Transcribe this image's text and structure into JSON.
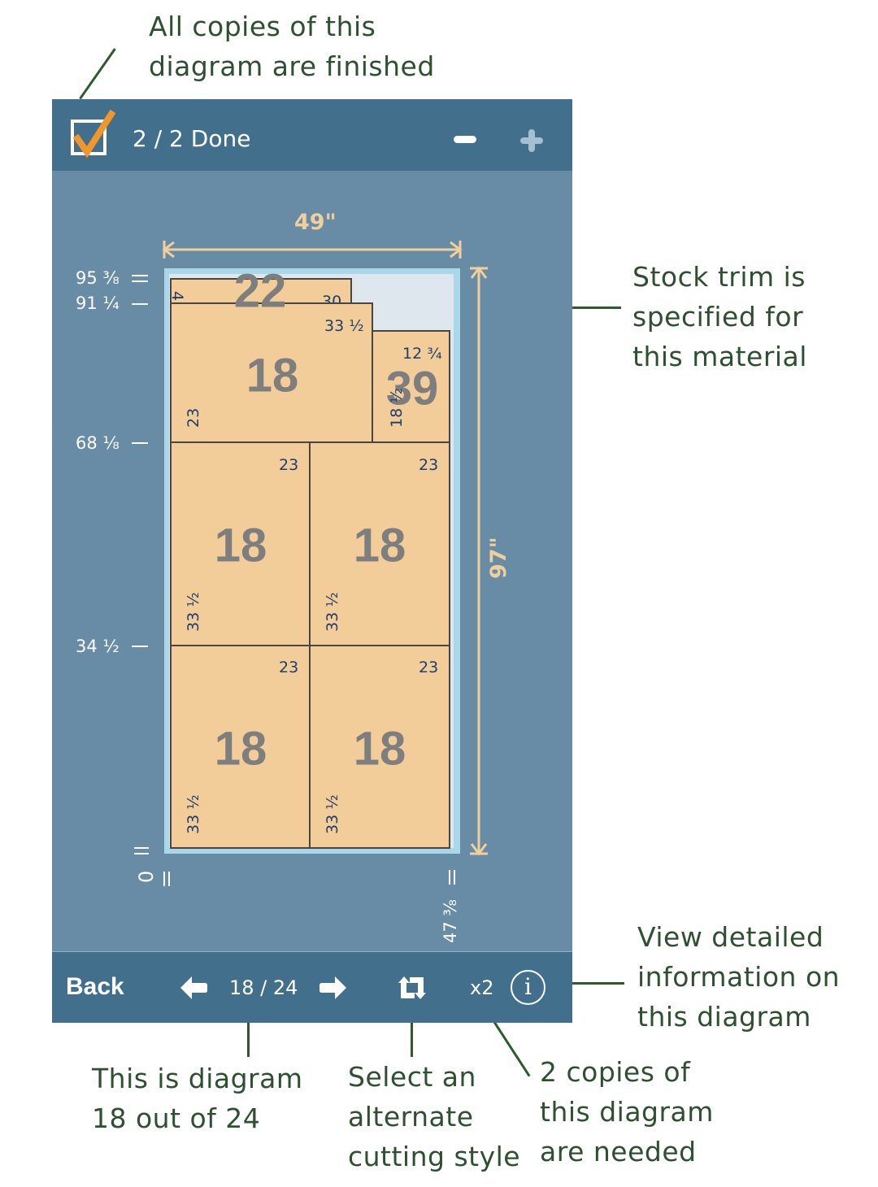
{
  "header": {
    "status": "2 / 2  Done",
    "checked": true,
    "minus_icon": "minus-icon",
    "plus_icon": "plus-icon"
  },
  "diagram": {
    "width_label": "49\"",
    "height_label": "97\"",
    "left_ticks": [
      "95 ³⁄₈",
      "91 ¹⁄₄",
      "68 ¹⁄₈",
      "34 ¹⁄₂",
      "0"
    ],
    "bottom_ticks": [
      "0",
      "47 ³⁄₈"
    ],
    "pieces": [
      {
        "number": "22",
        "width": "30",
        "height": "4"
      },
      {
        "number": "18",
        "width": "33 ½",
        "height": "23"
      },
      {
        "number": "39",
        "width": "12 ¾",
        "height": "18 ½"
      },
      {
        "number": "18",
        "width": "23",
        "height": "33 ½"
      },
      {
        "number": "18",
        "width": "23",
        "height": "33 ½"
      },
      {
        "number": "18",
        "width": "23",
        "height": "33 ½"
      },
      {
        "number": "18",
        "width": "23",
        "height": "33 ½"
      }
    ],
    "colors": {
      "piece": "#f2cd9a",
      "trim": "#dfe7ee",
      "sheet_border": "#a9d6e8",
      "dimension": "#efcf9c"
    }
  },
  "footer": {
    "back": "Back",
    "page": "18 / 24",
    "copies": "x2",
    "info_icon": "info-icon",
    "rotate_icon": "alternate-style-icon"
  },
  "annotations": {
    "done": "All copies of this\ndiagram are finished",
    "trim": "Stock trim is\nspecified for\nthis material",
    "info": "View detailed\ninformation on\nthis diagram",
    "page": "This is diagram\n18 out of 24",
    "style": "Select an\nalternate\ncutting style",
    "copies": "2 copies of\nthis diagram\nare needed"
  }
}
